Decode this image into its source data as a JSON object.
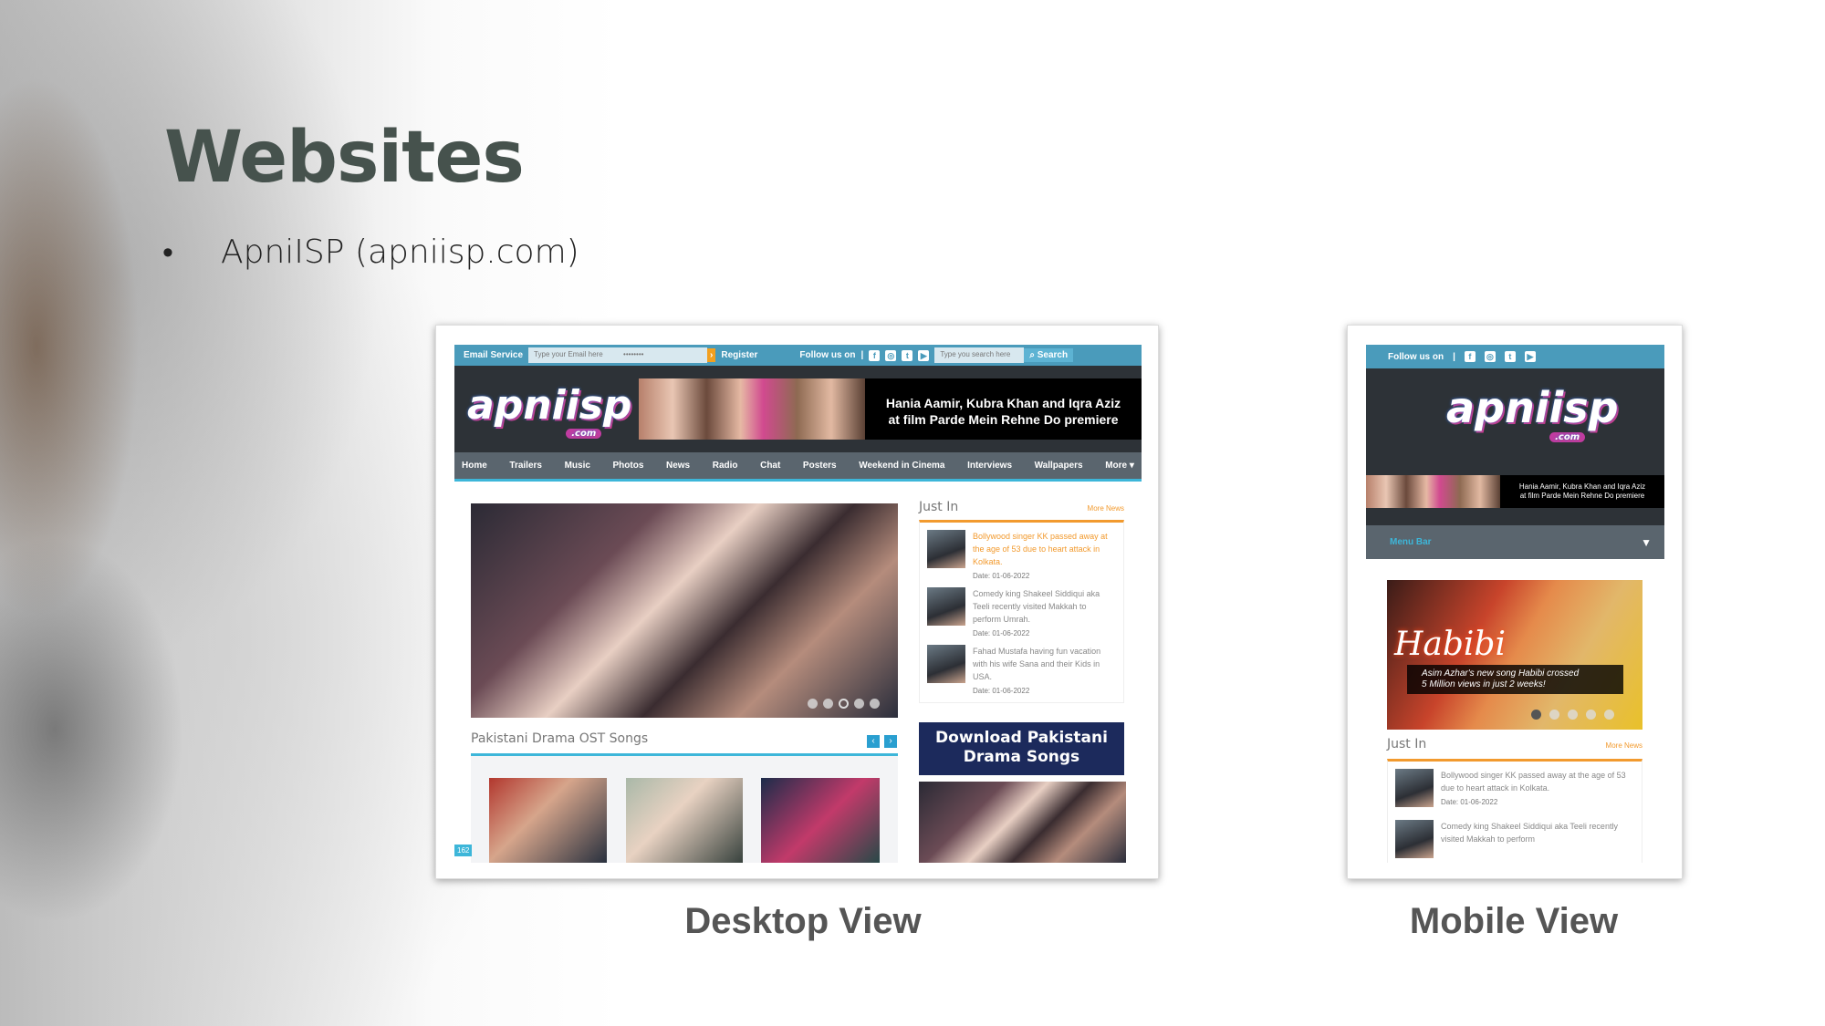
{
  "slide": {
    "title": "Websites",
    "bullet": "ApniISP (apniisp.com)",
    "desktop_caption": "Desktop View",
    "mobile_caption": "Mobile View"
  },
  "desktop": {
    "topbar": {
      "email_label": "Email Service",
      "email_placeholder": "Type your Email here",
      "password_value": "••••••••",
      "register": "Register",
      "follow": "Follow us on",
      "separator": "|",
      "search_placeholder": "Type you search here",
      "search_button": "Search"
    },
    "logo": {
      "name": "apniisp",
      ".com": ".com"
    },
    "ticker": [
      "Hania Aamir, Kubra Khan and Iqra Aziz",
      "at film Parde Mein Rehne Do premiere"
    ],
    "nav": [
      "Home",
      "Trailers",
      "Music",
      "Photos",
      "News",
      "Radio",
      "Chat",
      "Posters",
      "Weekend in Cinema",
      "Interviews",
      "Wallpapers",
      "More ▾"
    ],
    "slider": {
      "active_dot": 3,
      "dot_count": 5
    },
    "ost": {
      "title": "Pakistani Drama OST Songs",
      "prev": "‹",
      "next": "›",
      "badge": "162"
    },
    "just_in": {
      "title": "Just In",
      "more": "More News",
      "items": [
        {
          "text": "Bollywood singer KK passed away at the age of 53 due to heart attack in Kolkata.",
          "date": "Date: 01-06-2022"
        },
        {
          "text": "Comedy king Shakeel Siddiqui aka Teeli recently visited Makkah to perform Umrah.",
          "date": "Date: 01-06-2022"
        },
        {
          "text": "Fahad Mustafa having fun vacation with his wife Sana and their Kids in USA.",
          "date": "Date: 01-06-2022"
        }
      ]
    },
    "banner": [
      "Download Pakistani",
      "Drama Songs"
    ]
  },
  "mobile": {
    "follow": "Follow us on",
    "separator": "|",
    "ticker": [
      "Hania Aamir, Kubra Khan and Iqra Aziz",
      "at film Parde Mein Rehne Do premiere"
    ],
    "menu": "Menu Bar",
    "slide": {
      "script": "Habibi",
      "caption": [
        "Asim Azhar's new song Habibi crossed",
        "5 Million views in just 2 weeks!"
      ],
      "active_dot": 1,
      "dot_count": 5
    },
    "just_in": {
      "title": "Just In",
      "more": "More News",
      "items": [
        {
          "text": "Bollywood singer KK passed away at the age of 53 due to heart attack in Kolkata.",
          "date": "Date: 01-06-2022"
        },
        {
          "text": "Comedy king Shakeel Siddiqui aka Teeli recently visited Makkah to perform"
        }
      ]
    }
  },
  "social_icons": [
    "facebook-icon",
    "instagram-icon",
    "twitter-icon",
    "youtube-icon"
  ],
  "colors": {
    "topbar": "#4a9bbb",
    "header": "#2d3237",
    "nav": "#5a656e",
    "accent_orange": "#f29a2e",
    "accent_cyan": "#3db6d9"
  }
}
